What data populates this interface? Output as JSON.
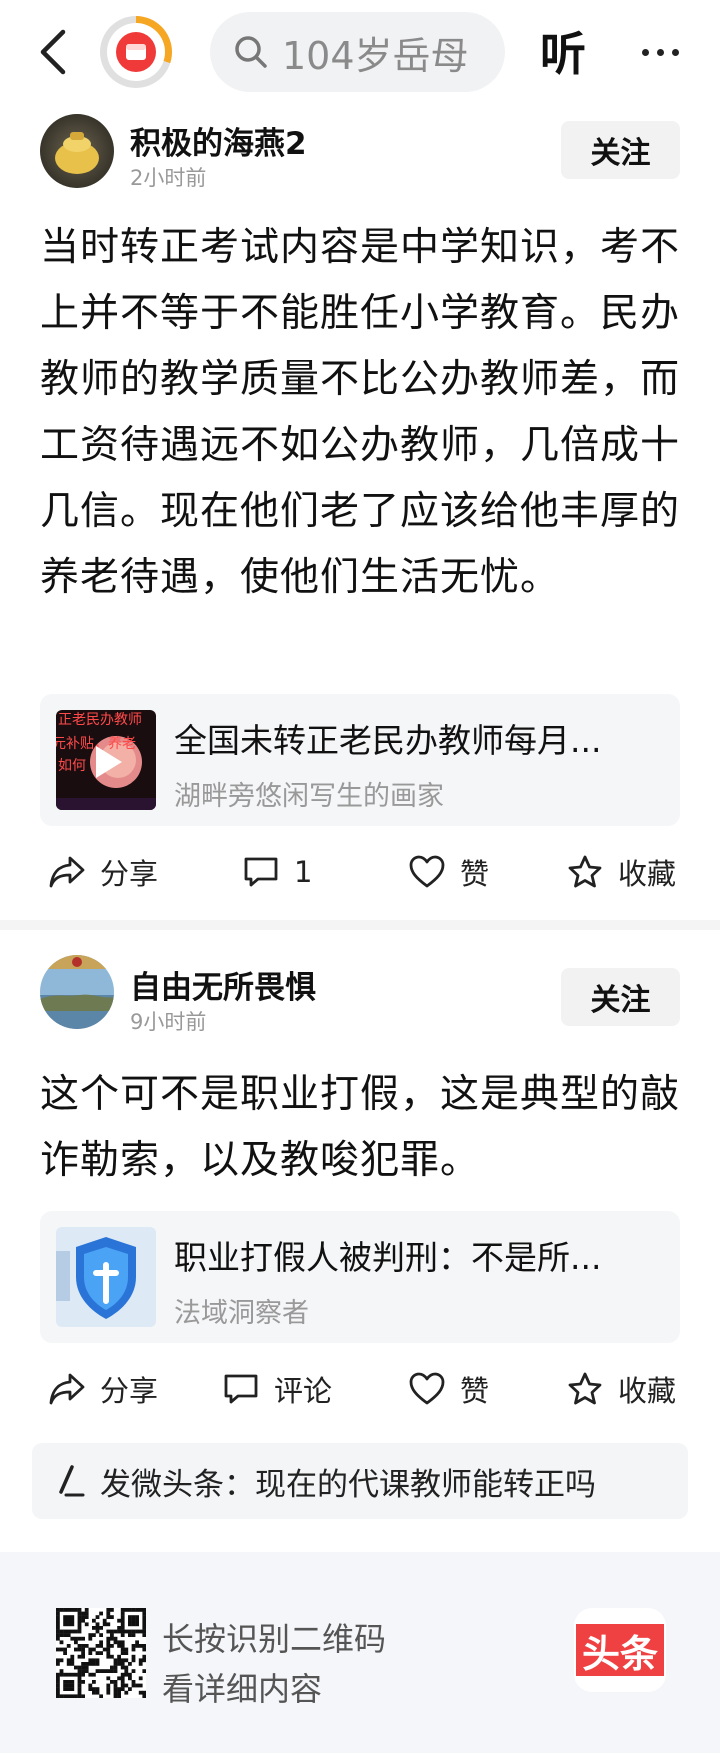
{
  "header": {
    "search_placeholder": "104岁岳母",
    "listen_label": "听"
  },
  "posts": [
    {
      "author": "积极的海燕2",
      "time": "2小时前",
      "follow_label": "关注",
      "text": "当时转正考试内容是中学知识，考不上并不等于不能胜任小学教育。民办教师的教学质量不比公办教师差，而工资待遇远不如公办教师，几倍成十几信。现在他们老了应该给他丰厚的养老待遇，使他们生活无忧。",
      "card": {
        "title": "全国未转正老民办教师每月...",
        "source": "湖畔旁悠闲写生的画家",
        "thumb_lines": [
          "正老民办教师",
          "元补贴，养老",
          "如何"
        ]
      },
      "actions": {
        "share": "分享",
        "comment": "1",
        "like": "赞",
        "collect": "收藏"
      }
    },
    {
      "author": "自由无所畏惧",
      "time": "9小时前",
      "follow_label": "关注",
      "text": "这个可不是职业打假，这是典型的敲诈勒索，以及教唆犯罪。",
      "card": {
        "title": "职业打假人被判刑：不是所...",
        "source": "法域洞察者"
      },
      "actions": {
        "share": "分享",
        "comment": "评论",
        "like": "赞",
        "collect": "收藏"
      }
    }
  ],
  "weitoutiao": {
    "label": "发微头条：现在的代课教师能转正吗"
  },
  "footer": {
    "line1": "长按识别二维码",
    "line2": "看详细内容",
    "logo_text": "头条"
  },
  "colors": {
    "accent_red": "#f04142",
    "badge_orange": "#f5a623"
  }
}
